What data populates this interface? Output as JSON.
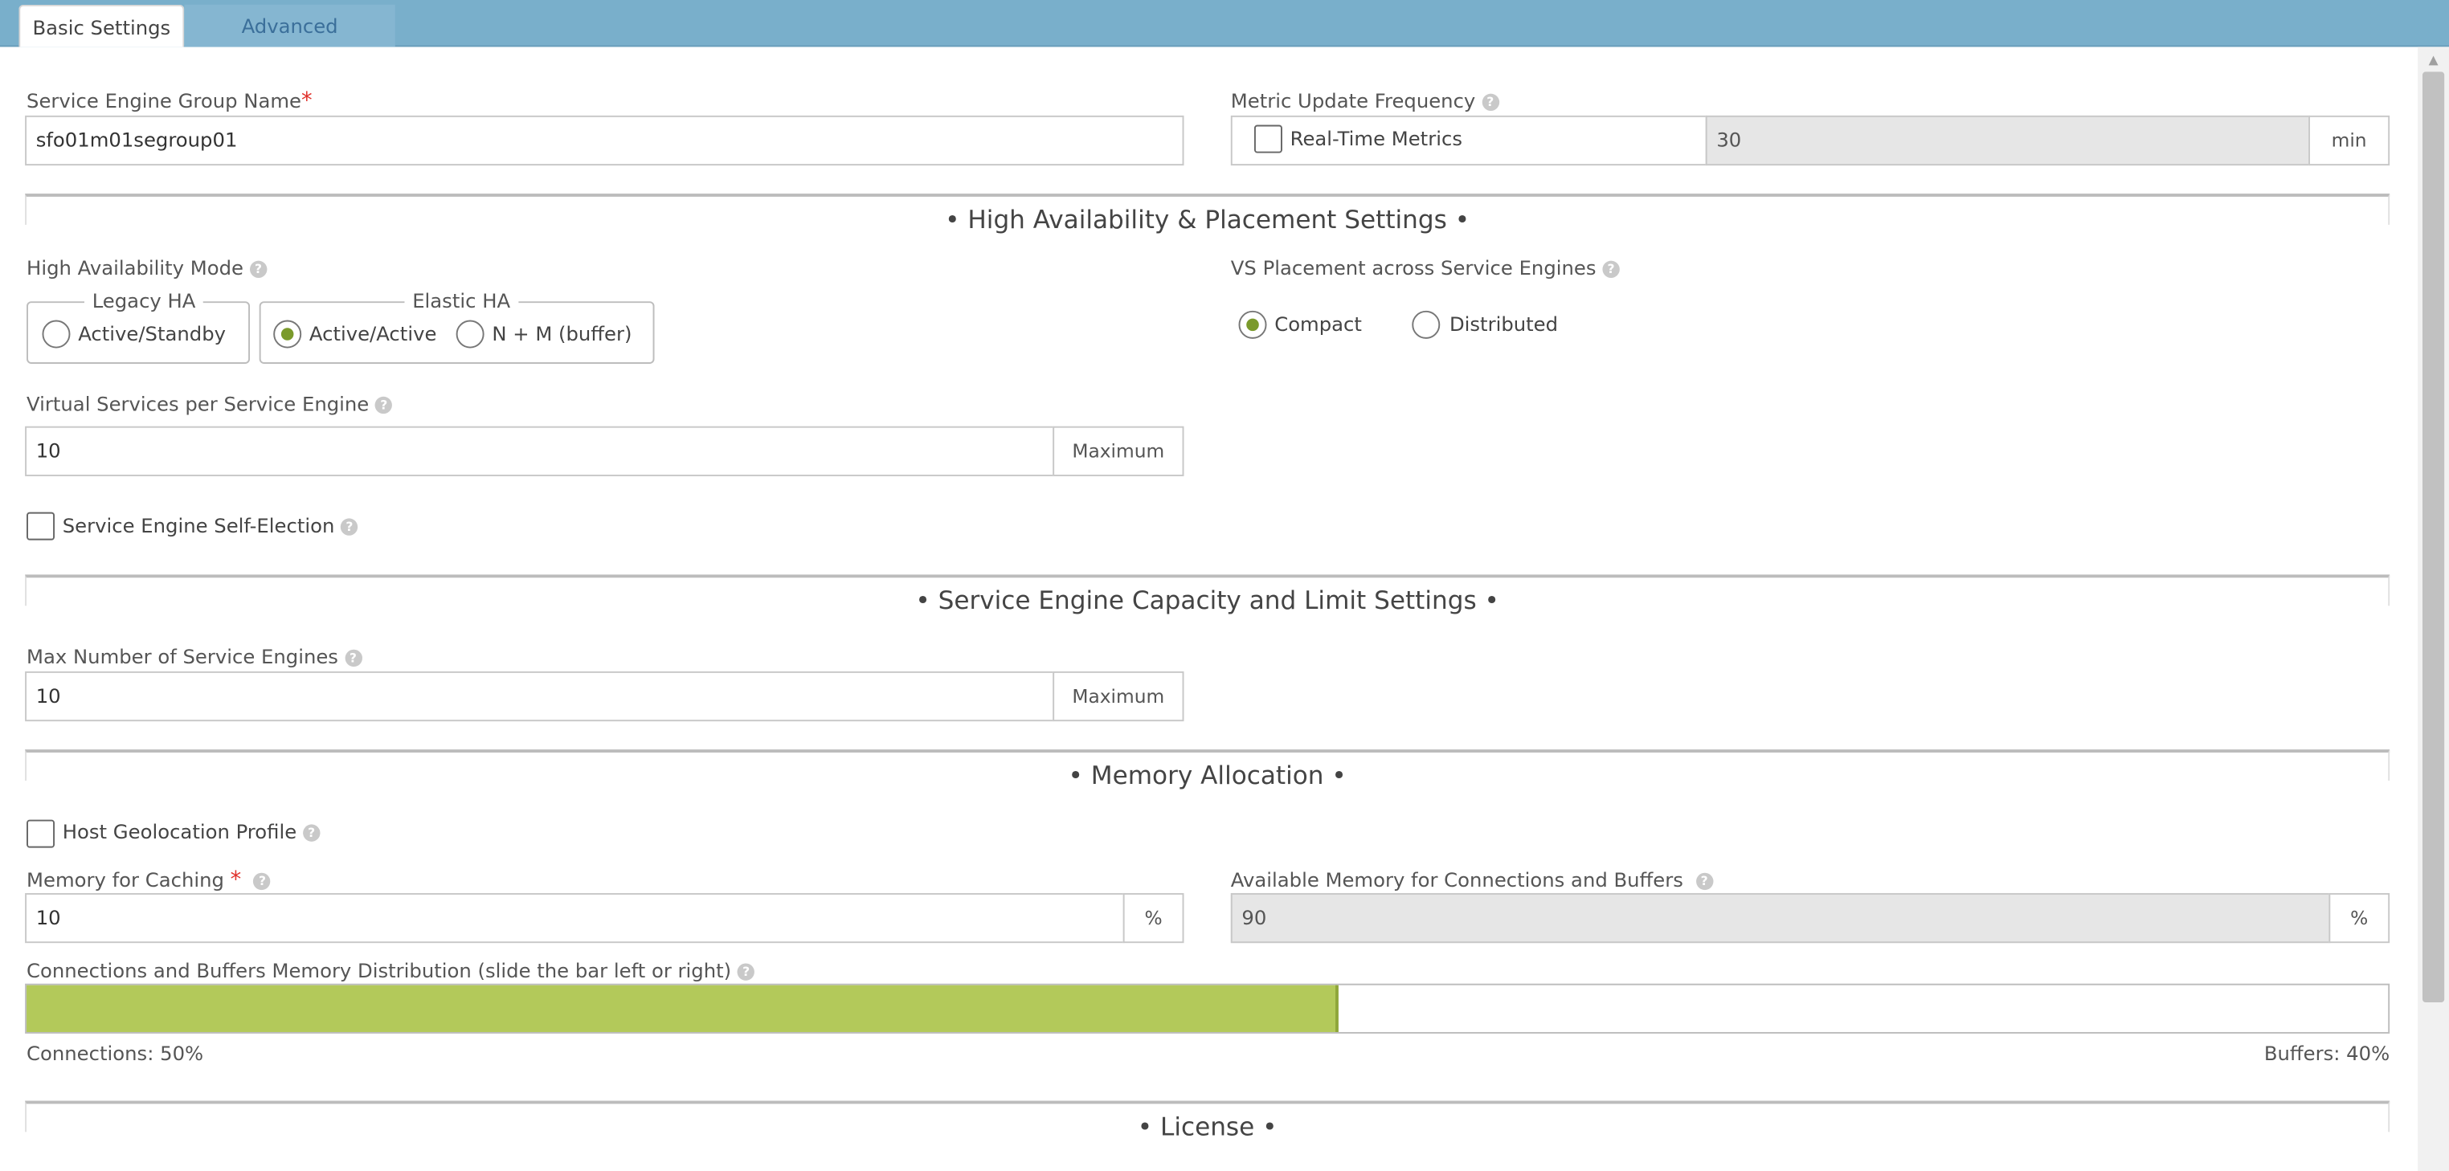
{
  "tabs": [
    {
      "label": "Basic Settings",
      "active": true
    },
    {
      "label": "Advanced",
      "active": false
    }
  ],
  "se_group_name": {
    "label": "Service Engine Group Name",
    "required_mark": "*",
    "value": "sfo01m01segroup01"
  },
  "metric_update": {
    "label": "Metric Update Frequency",
    "realtime_label": "Real-Time Metrics",
    "realtime_checked": false,
    "value": "30",
    "unit": "min"
  },
  "sections": {
    "ha": "• High Availability & Placement Settings •",
    "capacity": "•  Service Engine Capacity and Limit Settings  •",
    "memory": "• Memory Allocation •",
    "license": "• License •"
  },
  "ha_mode": {
    "label": "High Availability Mode",
    "legacy_legend": "Legacy HA",
    "elastic_legend": "Elastic HA",
    "options": [
      {
        "label": "Active/Standby",
        "checked": false
      },
      {
        "label": "Active/Active",
        "checked": true
      },
      {
        "label": "N + M (buffer)",
        "checked": false
      }
    ]
  },
  "vs_placement": {
    "label": "VS Placement across Service Engines",
    "options": [
      {
        "label": "Compact",
        "checked": true
      },
      {
        "label": "Distributed",
        "checked": false
      }
    ]
  },
  "vs_per_se": {
    "label": "Virtual Services per Service Engine",
    "value": "10",
    "addon": "Maximum"
  },
  "self_election": {
    "label": "Service Engine Self-Election",
    "checked": false
  },
  "max_se": {
    "label": "Max Number of Service Engines",
    "value": "10",
    "addon": "Maximum"
  },
  "host_geo": {
    "label": "Host Geolocation Profile",
    "checked": false
  },
  "memory_caching": {
    "label": "Memory for Caching",
    "required_mark": "*",
    "value": "10",
    "unit": "%"
  },
  "available_memory": {
    "label": "Available Memory for Connections and Buffers",
    "value": "90",
    "unit": "%"
  },
  "distribution": {
    "label": "Connections and Buffers Memory Distribution (slide the bar left or right)",
    "connections_label": "Connections: 50%",
    "buffers_label": "Buffers: 40%",
    "connections_fraction_of_bar": 0.555
  },
  "colors": {
    "tabbar": "#79afcb",
    "accent": "#7a9a2b",
    "bar_fill": "#b3c95a",
    "required": "#e0302a"
  },
  "icons": {
    "help": "question-circle-icon"
  }
}
